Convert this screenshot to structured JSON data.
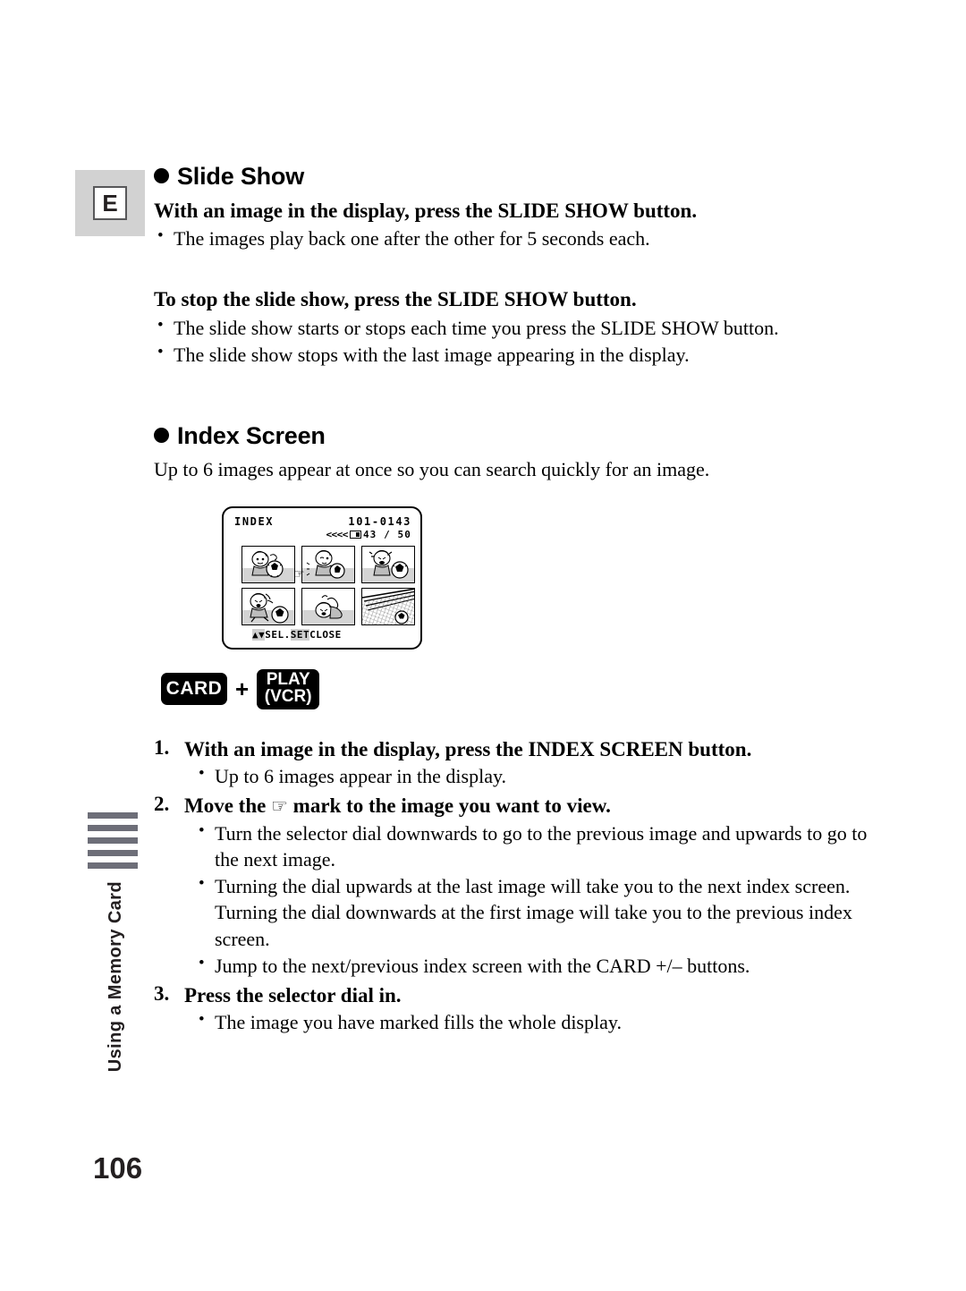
{
  "page": {
    "number": "106",
    "lang_badge": "E",
    "side_tab_label": "Using a Memory Card",
    "side_bar_count": 5
  },
  "sections": [
    {
      "title": "Slide Show",
      "blocks": [
        {
          "heading": "With an image in the display, press the SLIDE SHOW button.",
          "bullets": [
            "The images play back one after the other for 5 seconds each."
          ]
        },
        {
          "heading": "To stop the slide show, press the SLIDE SHOW button.",
          "bullets": [
            "The slide show starts or stops each time you press the SLIDE SHOW button.",
            "The slide show stops with the last image appearing in the display."
          ]
        }
      ]
    },
    {
      "title": "Index Screen",
      "intro": "Up to 6 images appear at once so you can search quickly for an image."
    }
  ],
  "lcd": {
    "mode_label": "INDEX",
    "file_number": "101-0143",
    "arrows": "<<<<",
    "counter": "43 / 50",
    "card_icon": "memory-card-icon",
    "footer": {
      "select_arrows": "▲▼",
      "select_label": "SEL",
      "separator": ".",
      "set_label": "SET",
      "close_label": "CLOSE"
    },
    "thumbnails": [
      {
        "id": 1,
        "caption": "baby-with-ball"
      },
      {
        "id": 2,
        "caption": "baby-holding-ball"
      },
      {
        "id": 3,
        "caption": "baby-crying-with-ball"
      },
      {
        "id": 4,
        "caption": "baby-kicking-ball"
      },
      {
        "id": 5,
        "caption": "baby-lying-down"
      },
      {
        "id": 6,
        "caption": "goal-net-with-ball"
      }
    ],
    "marker": "☞"
  },
  "buttons": {
    "card_label": "CARD",
    "plus": "+",
    "play_line1": "PLAY",
    "play_line2": "(VCR)"
  },
  "steps": [
    {
      "num": "1.",
      "title": "With an image in the display, press the INDEX SCREEN button.",
      "bullets": [
        "Up to 6 images appear in the display."
      ]
    },
    {
      "num": "2.",
      "title_before": "Move the ",
      "title_icon": "☞",
      "title_after": " mark to the image you want to view.",
      "bullets": [
        "Turn the selector dial downwards to go to the previous image and upwards to go to the next image.",
        "Turning the dial upwards at the last image will take you to the next index screen. Turning the dial downwards at the first image will take you to the previous index screen.",
        "Jump to the next/previous index screen with the CARD +/– buttons."
      ]
    },
    {
      "num": "3.",
      "title": "Press the selector dial in.",
      "bullets": [
        "The image you have marked fills the whole display."
      ]
    }
  ],
  "colors": {
    "badge_bg": "#d2d2d2",
    "side_bar": "#6d6e78",
    "text": "#000000",
    "lcd_ground": "#d4d4d4",
    "lcd_highlight": "#cfcfcf"
  }
}
